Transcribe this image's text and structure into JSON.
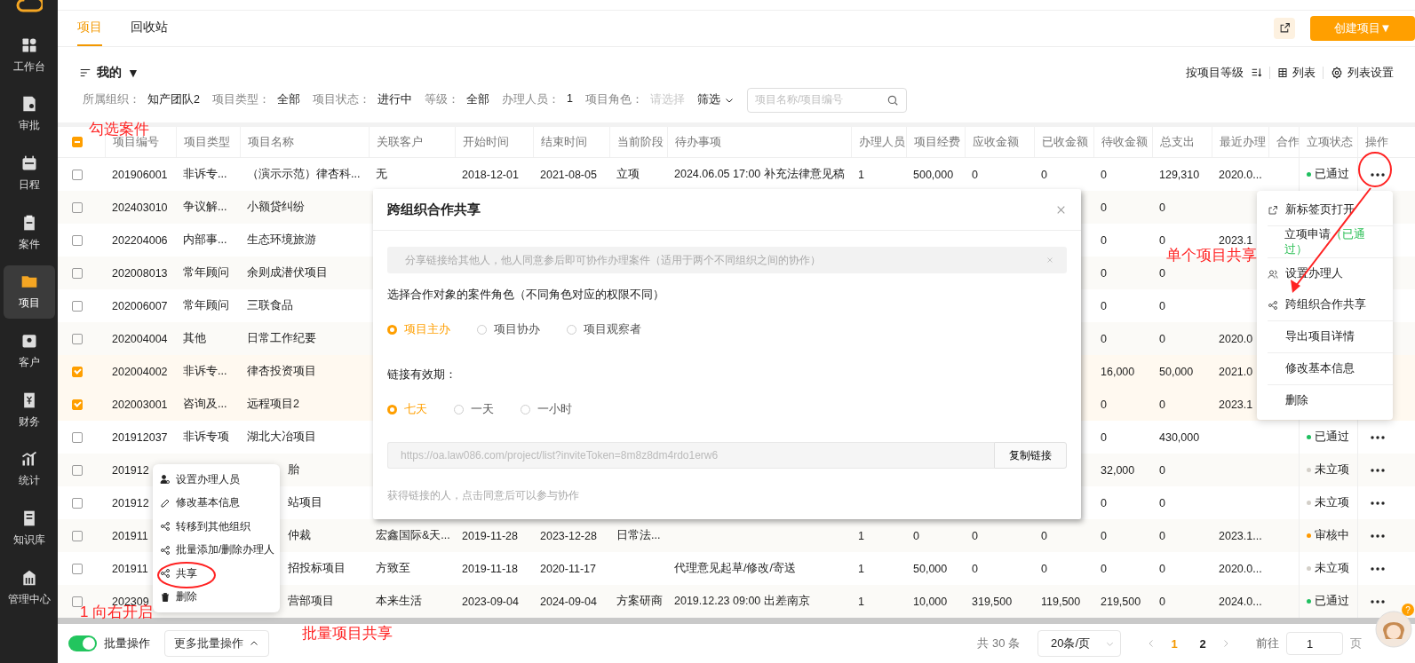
{
  "sidebar": {
    "items": [
      {
        "label": "工作台",
        "selected": false
      },
      {
        "label": "审批",
        "selected": false
      },
      {
        "label": "日程",
        "selected": false
      },
      {
        "label": "案件",
        "selected": false
      },
      {
        "label": "项目",
        "selected": true
      },
      {
        "label": "客户",
        "selected": false
      },
      {
        "label": "财务",
        "selected": false
      },
      {
        "label": "统计",
        "selected": false
      },
      {
        "label": "知识库",
        "selected": false
      },
      {
        "label": "管理中心",
        "selected": false
      }
    ]
  },
  "tabs": [
    {
      "label": "项目",
      "selected": true
    },
    {
      "label": "回收站",
      "selected": false
    }
  ],
  "create_button": "创建项目▼",
  "view": {
    "title": "我的",
    "caret": "▼",
    "sort": "按项目等级",
    "mode": "列表",
    "settings": "列表设置"
  },
  "filters": [
    {
      "label": "所属组织：",
      "value": "知产团队2"
    },
    {
      "label": "项目类型：",
      "value": "全部"
    },
    {
      "label": "项目状态：",
      "value": "进行中"
    },
    {
      "label": "等级：",
      "value": "全部"
    },
    {
      "label": "办理人员：",
      "value": "1"
    },
    {
      "label": "项目角色：",
      "placeholder": "请选择"
    }
  ],
  "filter_button": "筛选",
  "search": {
    "placeholder": "项目名称/项目编号"
  },
  "table": {
    "select_all_indeterminate": true,
    "columns": [
      "项目编号",
      "项目类型",
      "项目名称",
      "关联客户",
      "开始时间",
      "结束时间",
      "当前阶段",
      "待办事项",
      "办理人员",
      "项目经费",
      "应收金额",
      "已收金额",
      "待收金额",
      "总支出",
      "最近办理",
      "合作",
      "立项状态",
      "操作"
    ],
    "rows": [
      {
        "checked": false,
        "code": "201906001",
        "type": "非诉专...",
        "name": "（演示示范）律杏科...",
        "client": "无",
        "start": "2018-12-01",
        "end": "2021-08-05",
        "stage": "立项",
        "todo": "2024.06.05 17:00 补充法律意见稿",
        "staff": "1",
        "fee": "500,000",
        "receivable": "0",
        "received": "0",
        "pending": "0",
        "expense": "129,310",
        "recent": "2020.0...",
        "status": "已通过",
        "color": "#1fbf5f"
      },
      {
        "checked": false,
        "code": "202403010",
        "type": "争议解...",
        "name": "小额贷纠纷",
        "pending": "0",
        "expense": "0"
      },
      {
        "checked": false,
        "code": "202204006",
        "type": "内部事...",
        "name": "生态环境旅游",
        "pending": "0",
        "expense": "0",
        "recent": "2023.1"
      },
      {
        "checked": false,
        "code": "202008013",
        "type": "常年顾问",
        "name": "余则成潜伏项目",
        "pending": "0",
        "expense": "0"
      },
      {
        "checked": false,
        "code": "202006007",
        "type": "常年顾问",
        "name": "三联食品",
        "pending": "0",
        "expense": "0"
      },
      {
        "checked": false,
        "code": "202004004",
        "type": "其他",
        "name": "日常工作纪要",
        "pending": "0",
        "expense": "0",
        "recent": "2020.0"
      },
      {
        "checked": true,
        "code": "202004002",
        "type": "非诉专...",
        "name": "律杏投资项目",
        "pending": "16,000",
        "expense": "50,000",
        "recent": "2021.0"
      },
      {
        "checked": true,
        "code": "202003001",
        "type": "咨询及...",
        "name": "远程项目2",
        "pending": "0",
        "expense": "0",
        "recent": "2023.1"
      },
      {
        "checked": false,
        "code": "201912037",
        "type": "非诉专项",
        "name": "湖北大冶项目",
        "pending": "0",
        "expense": "430,000",
        "status": "已通过",
        "color": "#1fbf5f"
      },
      {
        "checked": false,
        "code": "201912",
        "name": "胎",
        "pending": "32,000",
        "expense": "0",
        "status": "未立项",
        "color": "#d3cfc8"
      },
      {
        "checked": false,
        "code": "201912",
        "name": "站项目",
        "pending": "0",
        "expense": "0",
        "status": "未立项",
        "color": "#d3cfc8"
      },
      {
        "checked": false,
        "code": "201911",
        "name": "仲裁",
        "client": "宏鑫国际&天...",
        "start": "2019-11-28",
        "end": "2023-12-28",
        "stage": "日常法...",
        "staff": "1",
        "fee": "0",
        "receivable": "0",
        "received": "0",
        "pending": "0",
        "expense": "0",
        "recent": "2023.1...",
        "status": "审核中",
        "color": "#ff9900"
      },
      {
        "checked": false,
        "code": "201911",
        "name": "招投标项目",
        "client": "方致至",
        "start": "2019-11-18",
        "end": "2020-11-17",
        "todo": "代理意见起草/修改/寄送",
        "staff": "1",
        "fee": "50,000",
        "receivable": "0",
        "received": "0",
        "pending": "0",
        "expense": "0",
        "recent": "2020.0...",
        "status": "未立项",
        "color": "#d3cfc8"
      },
      {
        "checked": false,
        "code": "202309",
        "name": "营部项目",
        "client": "本来生活",
        "start": "2023-09-04",
        "end": "2024-09-04",
        "stage": "方案研商",
        "todo": "2019.12.23 09:00 出差南京",
        "staff": "1",
        "fee": "10,000",
        "receivable": "319,500",
        "received": "119,500",
        "pending": "219,500",
        "expense": "0",
        "recent": "2024.0...",
        "status": "已通过",
        "color": "#1fbf5f"
      }
    ]
  },
  "dialog": {
    "title": "跨组织合作共享",
    "notice": "分享链接给其他人，他人同意参后即可协作办理案件（适用于两个不同组织之间的协作）",
    "role_label": "选择合作对象的案件角色（不同角色对应的权限不同）",
    "roles": [
      {
        "label": "项目主办",
        "selected": true
      },
      {
        "label": "项目协办",
        "selected": false
      },
      {
        "label": "项目观察者",
        "selected": false
      }
    ],
    "validity_label": "链接有效期：",
    "validity": [
      {
        "label": "七天",
        "selected": true
      },
      {
        "label": "一天",
        "selected": false
      },
      {
        "label": "一小时",
        "selected": false
      }
    ],
    "link": "https://oa.law086.com/project/list?inviteToken=8m8z8dm4rdo1erw6",
    "copy_button": "复制链接",
    "note": "获得链接的人，点击同意后可以参与协作"
  },
  "row_menu": {
    "items": [
      {
        "label": "新标签页打开"
      },
      {
        "label": "立项申请",
        "note": "（已通过）"
      },
      {
        "label": "设置办理人"
      },
      {
        "label": "跨组织合作共享"
      },
      {
        "label": "导出项目详情"
      },
      {
        "label": "修改基本信息"
      },
      {
        "label": "删除"
      }
    ]
  },
  "batch_menu": {
    "items": [
      "设置办理人员",
      "修改基本信息",
      "转移到其他组织",
      "批量添加/删除办理人",
      "共享",
      "删除"
    ]
  },
  "footer": {
    "toggle": {
      "label": "批量操作",
      "on": true
    },
    "more_button": "更多批量操作",
    "total": "共 30 条",
    "page_size": "20条/页",
    "pages": [
      {
        "label": "1",
        "selected": true
      },
      {
        "label": "2",
        "selected": false
      }
    ],
    "goto_label": "前往",
    "goto_value": "1",
    "page_suffix": "页",
    "help_badge": "?"
  },
  "annotations": [
    "勾选案件",
    "单个项目共享",
    "1 向右开启",
    "批量项目共享"
  ]
}
